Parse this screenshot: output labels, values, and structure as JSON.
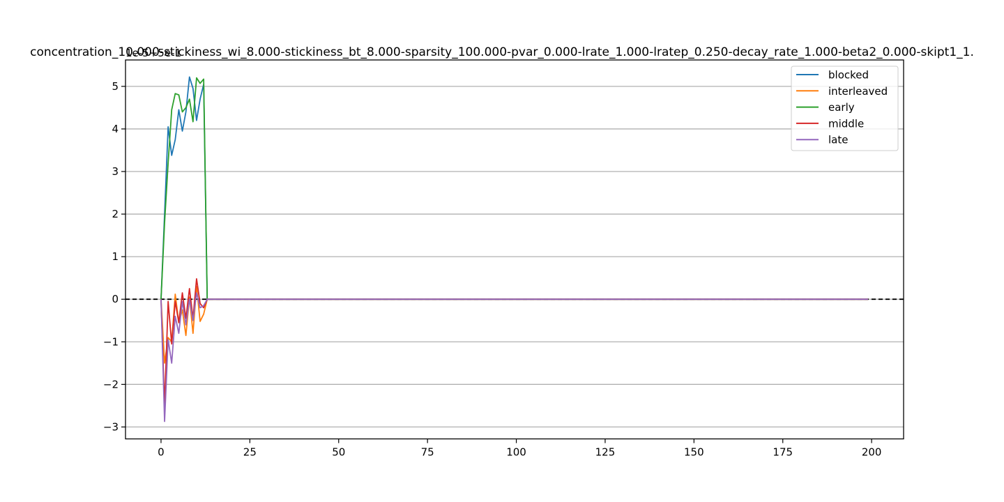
{
  "chart_data": {
    "type": "line",
    "title": "concentration_10.000-stickiness_wi_8.000-stickiness_bt_8.000-sparsity_100.000-pvar_0.000-lrate_1.000-lratep_0.250-decay_rate_1.000-beta2_0.000-skipt1_1.",
    "offset_text": "1e-5+5e-1",
    "xlim": [
      -10,
      209
    ],
    "ylim": [
      -3.28,
      5.62
    ],
    "x_ticks": [
      0,
      25,
      50,
      75,
      100,
      125,
      150,
      175,
      200
    ],
    "y_ticks": [
      -3,
      -2,
      -1,
      0,
      1,
      2,
      3,
      4,
      5
    ],
    "y_tick_labels": [
      "−3",
      "−2",
      "−1",
      "0",
      "1",
      "2",
      "3",
      "4",
      "5"
    ],
    "grid": "horizontal",
    "legend_position": "top-right",
    "reference_line": {
      "y": 0,
      "style": "dashed",
      "color": "#000000"
    },
    "x_end": 199,
    "series": [
      {
        "name": "blocked",
        "color": "#1f77b4",
        "values": [
          0,
          2.0,
          4.05,
          3.38,
          3.75,
          4.45,
          3.95,
          4.4,
          5.22,
          4.95,
          4.2,
          4.7,
          5.05,
          0
        ]
      },
      {
        "name": "interleaved",
        "color": "#ff7f0e",
        "values": [
          0,
          -1.5,
          -0.9,
          -1.0,
          0.12,
          -0.55,
          -0.25,
          -0.85,
          0.05,
          -0.8,
          0.3,
          -0.52,
          -0.35,
          0
        ]
      },
      {
        "name": "early",
        "color": "#2ca02c",
        "values": [
          0,
          1.8,
          3.2,
          4.45,
          4.83,
          4.8,
          4.4,
          4.5,
          4.7,
          4.17,
          5.2,
          5.07,
          5.17,
          0
        ]
      },
      {
        "name": "middle",
        "color": "#d62728",
        "values": [
          0,
          -2.5,
          -0.05,
          -1.05,
          -0.05,
          -0.55,
          0.15,
          -0.45,
          0.25,
          -0.45,
          0.48,
          -0.1,
          -0.2,
          0
        ]
      },
      {
        "name": "late",
        "color": "#9467bd",
        "values": [
          0,
          -2.87,
          -0.95,
          -1.5,
          -0.4,
          -0.8,
          -0.05,
          -0.6,
          0.0,
          -0.5,
          0.15,
          -0.2,
          -0.15,
          0
        ]
      }
    ]
  }
}
